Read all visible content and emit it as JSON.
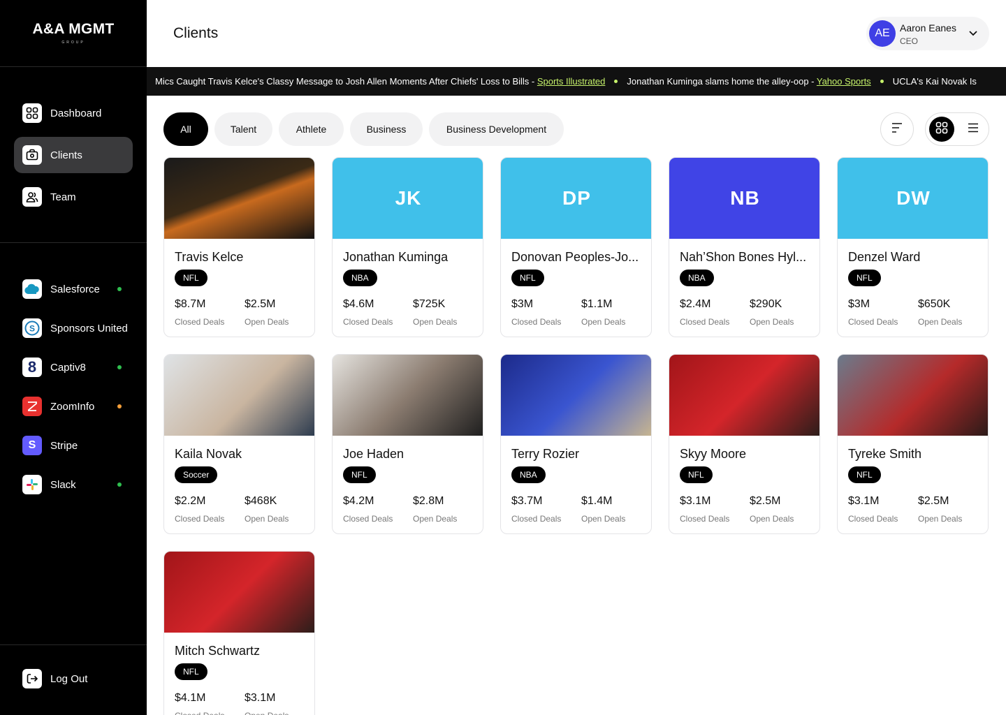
{
  "brand": {
    "name": "A&A MGMT",
    "sub": "GROUP"
  },
  "nav": [
    {
      "label": "Dashboard",
      "icon": "grid-icon",
      "active": false
    },
    {
      "label": "Clients",
      "icon": "briefcase-icon",
      "active": true
    },
    {
      "label": "Team",
      "icon": "users-icon",
      "active": false
    }
  ],
  "integrations": [
    {
      "label": "Salesforce",
      "icon": "salesforce-icon",
      "status": "#2fbf4f"
    },
    {
      "label": "Sponsors United",
      "icon": "sponsors-united-icon",
      "status": null
    },
    {
      "label": "Captiv8",
      "icon": "captiv8-icon",
      "status": "#2fbf4f"
    },
    {
      "label": "ZoomInfo",
      "icon": "zoominfo-icon",
      "status": "#f59f3a"
    },
    {
      "label": "Stripe",
      "icon": "stripe-icon",
      "status": null
    },
    {
      "label": "Slack",
      "icon": "slack-icon",
      "status": "#2fbf4f"
    }
  ],
  "logout_label": "Log Out",
  "header": {
    "title": "Clients"
  },
  "user": {
    "initials": "AE",
    "name": "Aaron Eanes",
    "role": "CEO"
  },
  "ticker": [
    {
      "text": "Mics Caught Travis Kelce's Classy Message to Josh Allen Moments After Chiefs' Loss to Bills - ",
      "source": "Sports Illustrated"
    },
    {
      "text": "Jonathan Kuminga slams home the alley-oop - ",
      "source": "Yahoo Sports"
    },
    {
      "text": "UCLA's Kai Novak Is",
      "source": ""
    }
  ],
  "filters": [
    "All",
    "Talent",
    "Athlete",
    "Business",
    "Business Development"
  ],
  "active_filter": "All",
  "stat_labels": {
    "closed": "Closed Deals",
    "open": "Open Deals"
  },
  "clients": [
    {
      "name": "Travis Kelce",
      "league": "NFL",
      "closed": "$8.7M",
      "open": "$2.5M",
      "initials": "",
      "photo": "photo-dark"
    },
    {
      "name": "Jonathan Kuminga",
      "league": "NBA",
      "closed": "$4.6M",
      "open": "$725K",
      "initials": "JK",
      "bg": "#40c0ea"
    },
    {
      "name": "Donovan Peoples-Jo...",
      "league": "NFL",
      "closed": "$3M",
      "open": "$1.1M",
      "initials": "DP",
      "bg": "#40c0ea"
    },
    {
      "name": "Nah’Shon Bones Hyl...",
      "league": "NBA",
      "closed": "$2.4M",
      "open": "$290K",
      "initials": "NB",
      "bg": "#4044e6"
    },
    {
      "name": "Denzel Ward",
      "league": "NFL",
      "closed": "$3M",
      "open": "$650K",
      "initials": "DW",
      "bg": "#40c0ea"
    },
    {
      "name": "Kaila Novak",
      "league": "Soccer",
      "closed": "$2.2M",
      "open": "$468K",
      "initials": "",
      "photo": "photo-light"
    },
    {
      "name": "Joe Haden",
      "league": "NFL",
      "closed": "$4.2M",
      "open": "$2.8M",
      "initials": "",
      "photo": "photo-grey"
    },
    {
      "name": "Terry Rozier",
      "league": "NBA",
      "closed": "$3.7M",
      "open": "$1.4M",
      "initials": "",
      "photo": "photo-blue"
    },
    {
      "name": "Skyy Moore",
      "league": "NFL",
      "closed": "$3.1M",
      "open": "$2.5M",
      "initials": "",
      "photo": "photo-red"
    },
    {
      "name": "Tyreke Smith",
      "league": "NFL",
      "closed": "$3.1M",
      "open": "$2.5M",
      "initials": "",
      "photo": "photo-stadium"
    },
    {
      "name": "Mitch Schwartz",
      "league": "NFL",
      "closed": "$4.1M",
      "open": "$3.1M",
      "initials": "",
      "photo": "photo-red"
    }
  ]
}
